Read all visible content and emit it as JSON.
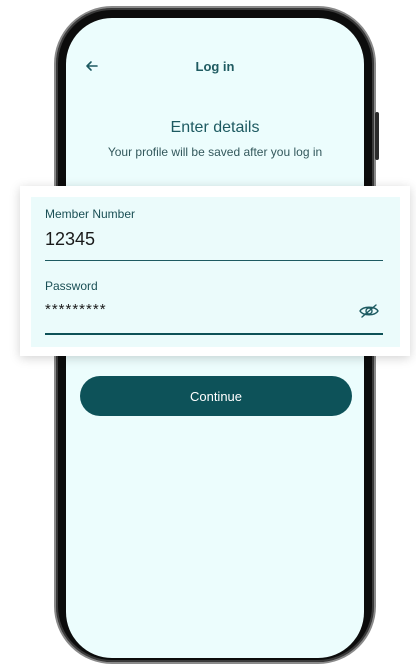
{
  "header": {
    "title": "Log in"
  },
  "intro": {
    "heading": "Enter details",
    "subheading": "Your profile will be saved after you log in"
  },
  "form": {
    "member_number": {
      "label": "Member Number",
      "value": "12345"
    },
    "password": {
      "label": "Password",
      "value": "*********"
    }
  },
  "actions": {
    "continue_label": "Continue"
  },
  "colors": {
    "screen_background": "#ecfdfd",
    "primary": "#0d5259",
    "accent_text": "#1d5a61"
  },
  "icons": {
    "back": "arrow-left-icon",
    "password_visibility": "eye-off-icon"
  }
}
